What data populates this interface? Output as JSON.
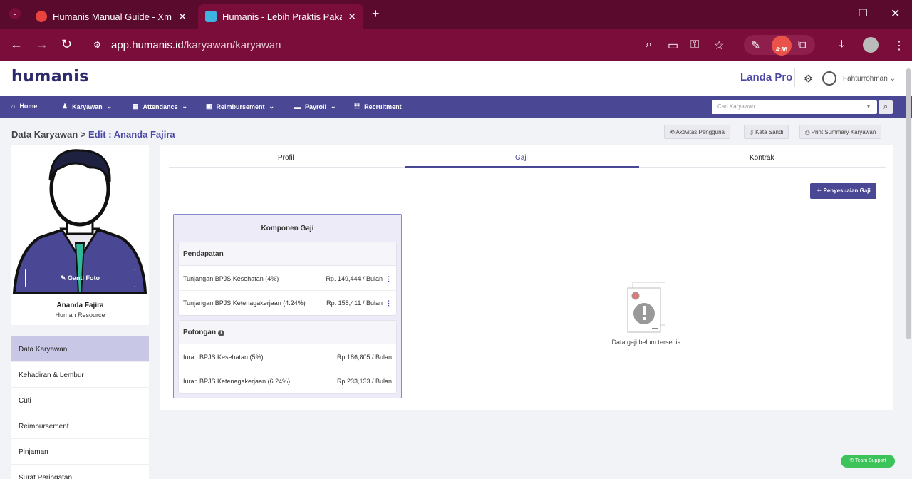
{
  "browser": {
    "tabs": [
      {
        "title": "Humanis Manual Guide - Xmind",
        "active": false
      },
      {
        "title": "Humanis - Lebih Praktis Pakai H",
        "active": true
      }
    ],
    "url_host": "app.humanis.id",
    "url_path": "/karyawan/karyawan",
    "timer_badge": "4:36"
  },
  "app": {
    "logo": "humanis",
    "company": "Landa Pro",
    "user": "Fahturrohman"
  },
  "nav": [
    {
      "label": "Home",
      "icon": "home-icon"
    },
    {
      "label": "Karyawan",
      "icon": "user-edit-icon"
    },
    {
      "label": "Attendance",
      "icon": "calendar-icon"
    },
    {
      "label": "Reimbursement",
      "icon": "money-icon"
    },
    {
      "label": "Payroll",
      "icon": "wallet-icon"
    },
    {
      "label": "Recruitment",
      "icon": "users-icon"
    }
  ],
  "search": {
    "placeholder": "Cari Karyawan"
  },
  "breadcrumb": {
    "root": "Data Karyawan",
    "current": "Edit : Ananda Fajira"
  },
  "actions": [
    "Aktivitas Pengguna",
    "Kata Sandi",
    "Print Summary Karyawan"
  ],
  "profile": {
    "change_photo": "Ganti Foto",
    "name": "Ananda Fajira",
    "role": "Human Resource"
  },
  "side_menu": [
    "Data Karyawan",
    "Kehadiran & Lembur",
    "Cuti",
    "Reimbursement",
    "Pinjaman",
    "Surat Peringatan"
  ],
  "tabs": [
    "Profil",
    "Gaji",
    "Kontrak"
  ],
  "salary": {
    "adjust_button": "Penyesuaian Gaji",
    "component_title": "Komponen Gaji",
    "income": {
      "title": "Pendapatan",
      "rows": [
        {
          "label": "Tunjangan BPJS Kesehatan (4%)",
          "value": "Rp. 149,444 / Bulan"
        },
        {
          "label": "Tunjangan BPJS Ketenagakerjaan (4.24%)",
          "value": "Rp. 158,411 / Bulan"
        }
      ]
    },
    "deduction": {
      "title": "Potongan",
      "rows": [
        {
          "label": "Iuran BPJS Kesehatan (5%)",
          "value": "Rp 186,805 / Bulan"
        },
        {
          "label": "Iuran BPJS Ketenagakerjaan (6.24%)",
          "value": "Rp 233,133 / Bulan"
        }
      ]
    },
    "empty_text": "Data gaji belum tersedia"
  },
  "support": "Team Support"
}
